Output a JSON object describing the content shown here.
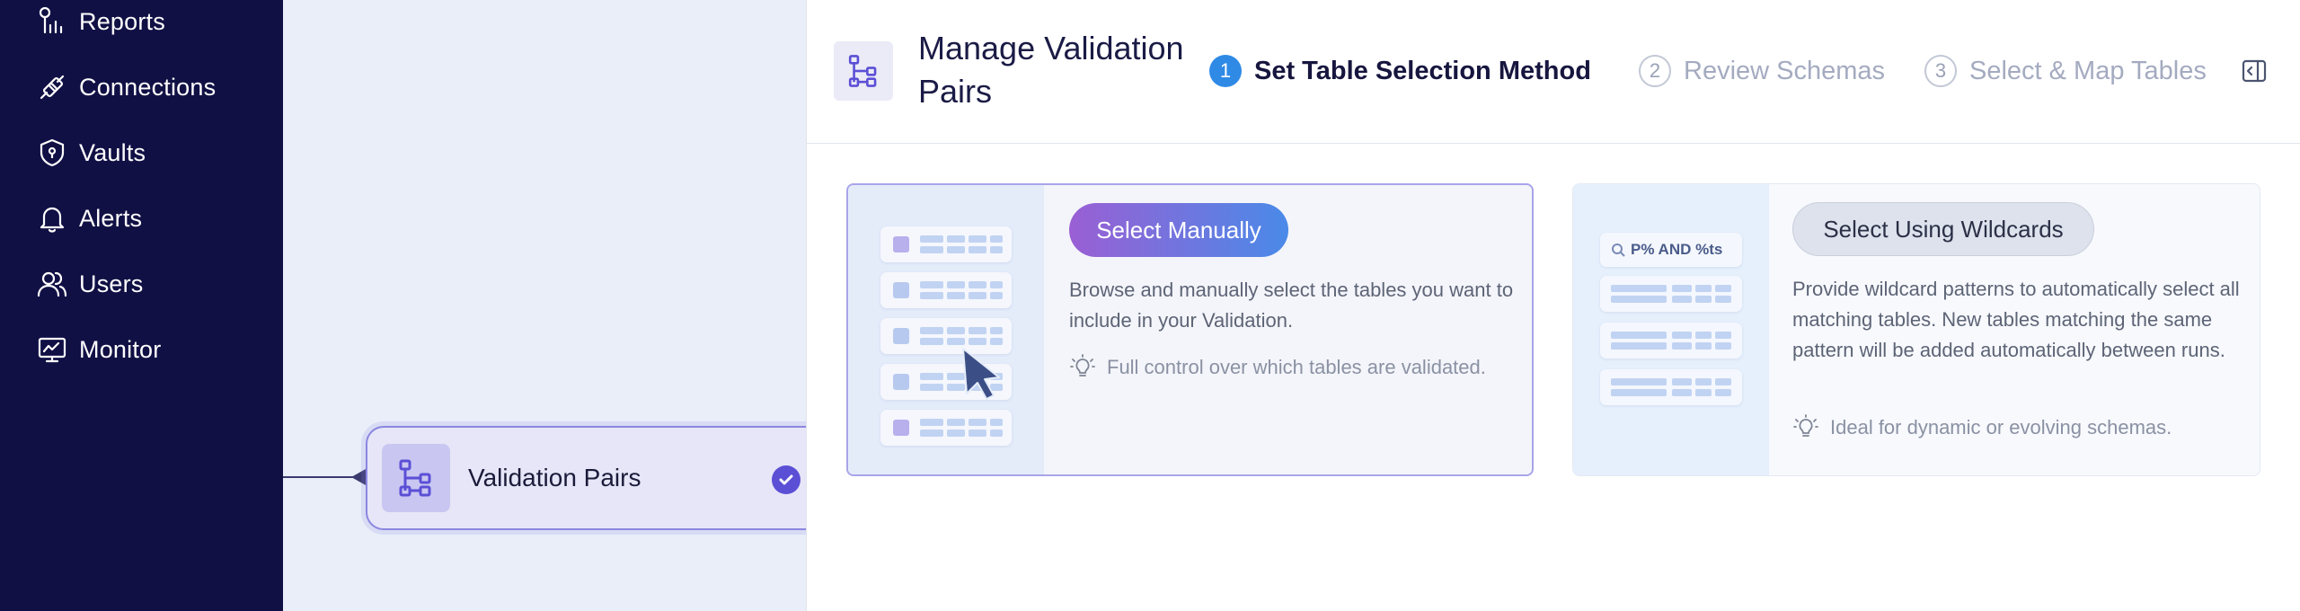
{
  "sidebar": {
    "items": [
      {
        "label": "Reports",
        "icon": "reports-icon"
      },
      {
        "label": "Connections",
        "icon": "connections-icon"
      },
      {
        "label": "Vaults",
        "icon": "vault-shield-icon"
      },
      {
        "label": "Alerts",
        "icon": "bell-icon"
      },
      {
        "label": "Users",
        "icon": "users-icon"
      },
      {
        "label": "Monitor",
        "icon": "monitor-icon"
      }
    ]
  },
  "canvas": {
    "node": {
      "label": "Validation Pairs",
      "status": "selected"
    }
  },
  "panel": {
    "title": "Manage Validation Pairs",
    "steps": [
      {
        "number": "1",
        "label": "Set Table Selection Method",
        "state": "active"
      },
      {
        "number": "2",
        "label": "Review Schemas",
        "state": "inactive"
      },
      {
        "number": "3",
        "label": "Select & Map Tables",
        "state": "inactive"
      }
    ],
    "options": [
      {
        "button": "Select Manually",
        "description": "Browse and manually select the tables you want to include in your Validation.",
        "tip": "Full control over which tables are validated.",
        "selected": true
      },
      {
        "button": "Select Using Wildcards",
        "search_chip": "P% AND %ts",
        "description": "Provide wildcard patterns to automatically select all matching tables. New tables matching the same pattern will be added automatically between runs.",
        "tip": "Ideal for dynamic or evolving schemas.",
        "selected": false
      }
    ]
  },
  "colors": {
    "sidebar_bg": "#111045",
    "accent_purple": "#5b4fd6",
    "step_active": "#2f8ae6",
    "gradient_start": "#9a5fd4",
    "gradient_end": "#4a8ae8"
  }
}
